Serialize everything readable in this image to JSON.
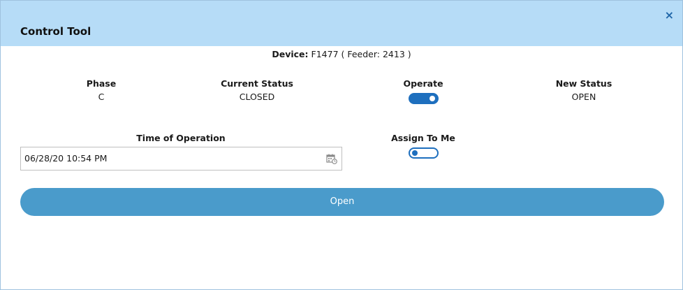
{
  "dialog": {
    "title": "Control Tool",
    "close_glyph": "×"
  },
  "device": {
    "label": "Device:",
    "value": "F1477 ( Feeder: 2413 )"
  },
  "columns": {
    "phase": {
      "label": "Phase",
      "value": "C"
    },
    "current_status": {
      "label": "Current Status",
      "value": "CLOSED"
    },
    "operate": {
      "label": "Operate",
      "toggle_on": true
    },
    "new_status": {
      "label": "New Status",
      "value": "OPEN"
    }
  },
  "time_of_operation": {
    "label": "Time of Operation",
    "value": "06/28/20 10:54 PM",
    "icon": "calendar-clock-icon"
  },
  "assign_to_me": {
    "label": "Assign To Me",
    "toggle_on": false
  },
  "open_button": {
    "label": "Open"
  },
  "colors": {
    "header_bg": "#b6dcf7",
    "accent": "#1e6fbe",
    "button_bg": "#4a9bcb"
  }
}
